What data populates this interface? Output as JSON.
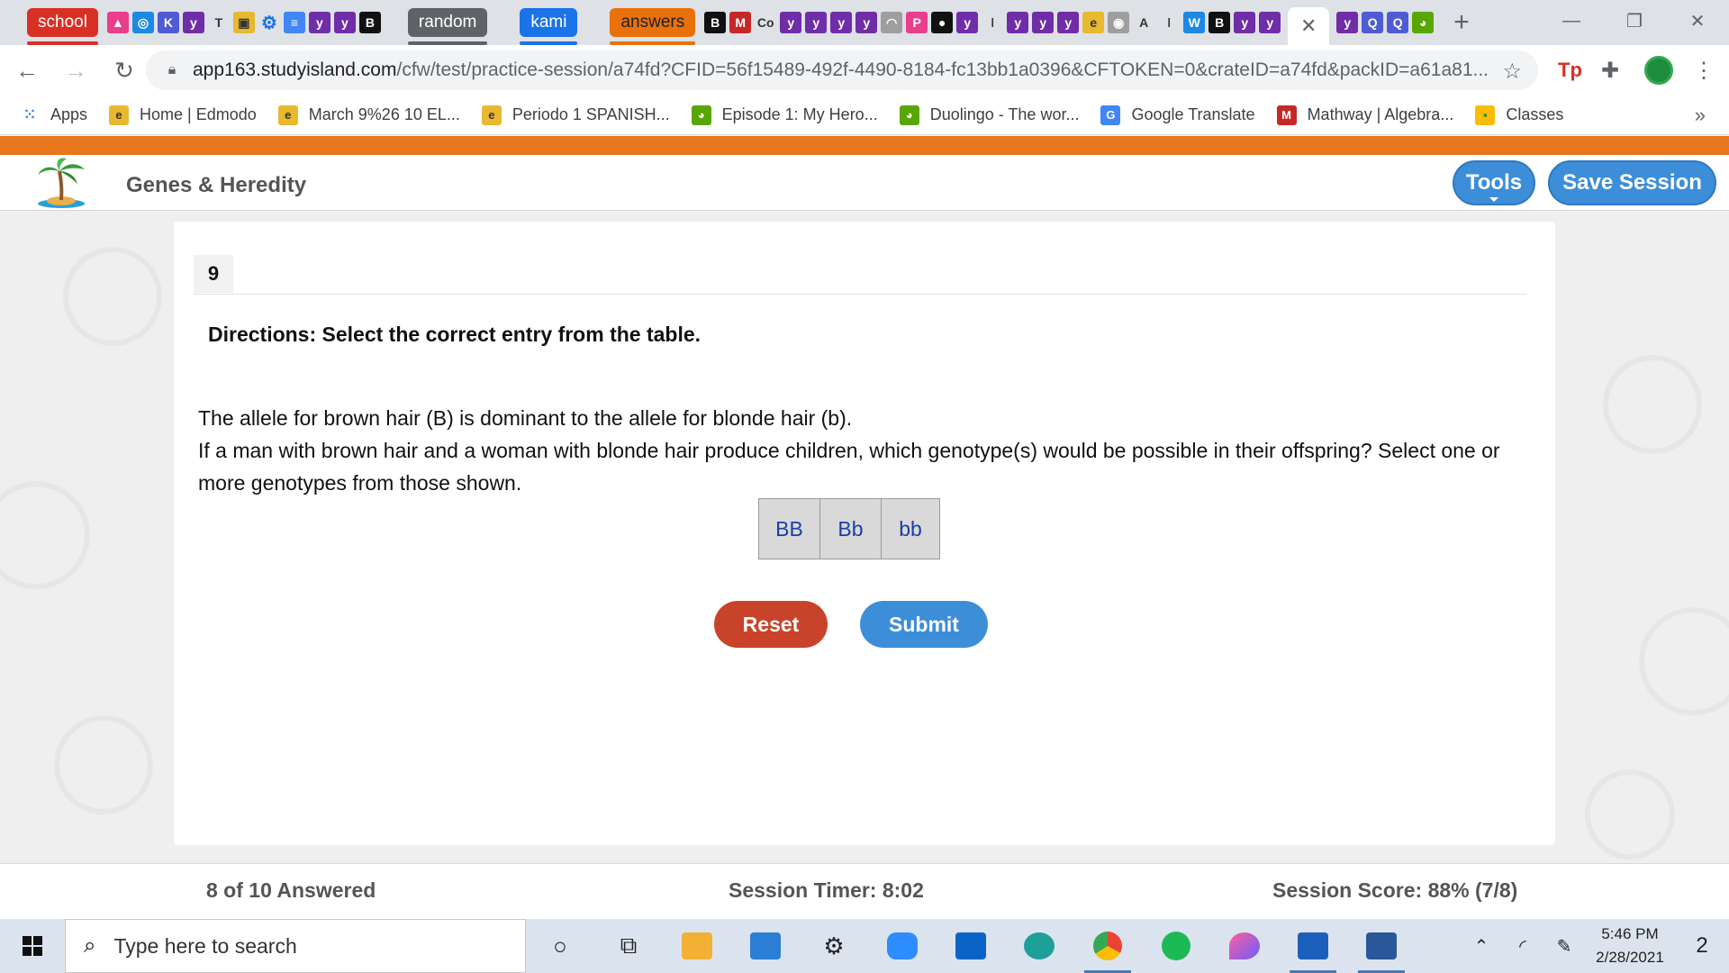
{
  "browser": {
    "tab_groups": [
      {
        "label": "school",
        "color": "#d93025"
      },
      {
        "label": "random",
        "color": "#5f6368"
      },
      {
        "label": "kami",
        "color": "#1a73e8"
      },
      {
        "label": "answers",
        "color": "#e8710a"
      }
    ],
    "active_tab_close": "✕",
    "new_tab": "+",
    "address": {
      "host": "app163.studyisland.com",
      "path": "/cfw/test/practice-session/a74fd?CFID=56f15489-492f-4490-8184-fc13bb1a0396&CFTOKEN=0&crateID=a74fd&packID=a61a81..."
    },
    "bookmarks": [
      {
        "label": "Apps",
        "icon": "apps-grid-icon"
      },
      {
        "label": "Home | Edmodo",
        "icon": "edmodo-icon"
      },
      {
        "label": "March 9%26 10 EL...",
        "icon": "edmodo-icon"
      },
      {
        "label": "Periodo 1 SPANISH...",
        "icon": "edmodo-icon"
      },
      {
        "label": "Episode 1: My Hero...",
        "icon": "duolingo-icon"
      },
      {
        "label": "Duolingo - The wor...",
        "icon": "duolingo-icon"
      },
      {
        "label": "Google Translate",
        "icon": "google-translate-icon"
      },
      {
        "label": "Mathway | Algebra...",
        "icon": "mathway-icon"
      },
      {
        "label": "Classes",
        "icon": "classroom-icon"
      }
    ],
    "bookmarks_more": "»"
  },
  "app": {
    "title": "Genes & Heredity",
    "tools_label": "Tools",
    "save_label": "Save Session",
    "accent": "#3d8ed8",
    "brand_bar_color": "#e8761c"
  },
  "question": {
    "number": "9",
    "directions": "Directions: Select the correct entry from the table.",
    "lines": [
      "The allele for brown hair (B) is dominant to the allele for blonde hair (b).",
      "If a man with brown hair and a woman with blonde hair produce children, which genotype(s) would be possible in their offspring? Select one or more genotypes from those shown."
    ],
    "choices": [
      "BB",
      "Bb",
      "bb"
    ],
    "reset_label": "Reset",
    "submit_label": "Submit"
  },
  "footer": {
    "answered": "8 of 10 Answered",
    "timer": "Session Timer: 8:02",
    "score": "Session Score: 88% (7/8)"
  },
  "taskbar": {
    "search_placeholder": "Type here to search",
    "time": "5:46 PM",
    "date": "2/28/2021",
    "notifications": "2"
  }
}
